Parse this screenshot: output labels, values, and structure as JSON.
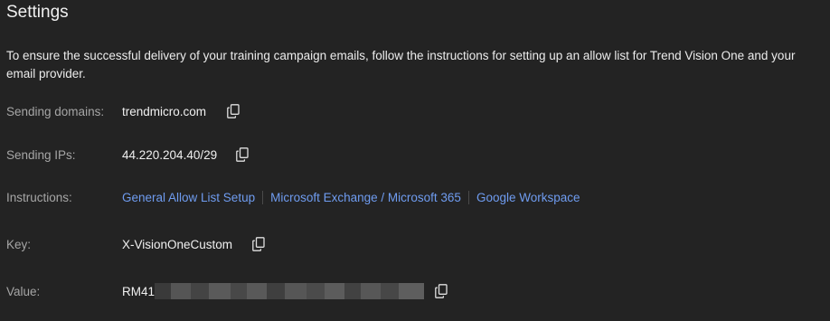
{
  "page": {
    "title": "Settings",
    "intro": "To ensure the successful delivery of your training campaign emails, follow the instructions for setting up an allow list for Trend Vision One and your email provider."
  },
  "rows": {
    "sending_domains": {
      "label": "Sending domains:",
      "value": "trendmicro.com"
    },
    "sending_ips": {
      "label": "Sending IPs:",
      "value": "44.220.204.40/29"
    },
    "instructions": {
      "label": "Instructions:",
      "links": [
        "General Allow List Setup",
        "Microsoft Exchange / Microsoft 365",
        "Google Workspace"
      ]
    },
    "key": {
      "label": "Key:",
      "value": "X-VisionOneCustom"
    },
    "value": {
      "label": "Value:",
      "value": "RM41"
    }
  },
  "icons": {
    "copy": "copy-icon"
  },
  "colors": {
    "background": "#232323",
    "link": "#6f9cf0",
    "label": "#a6a6a6",
    "text": "#f0f0f0"
  }
}
